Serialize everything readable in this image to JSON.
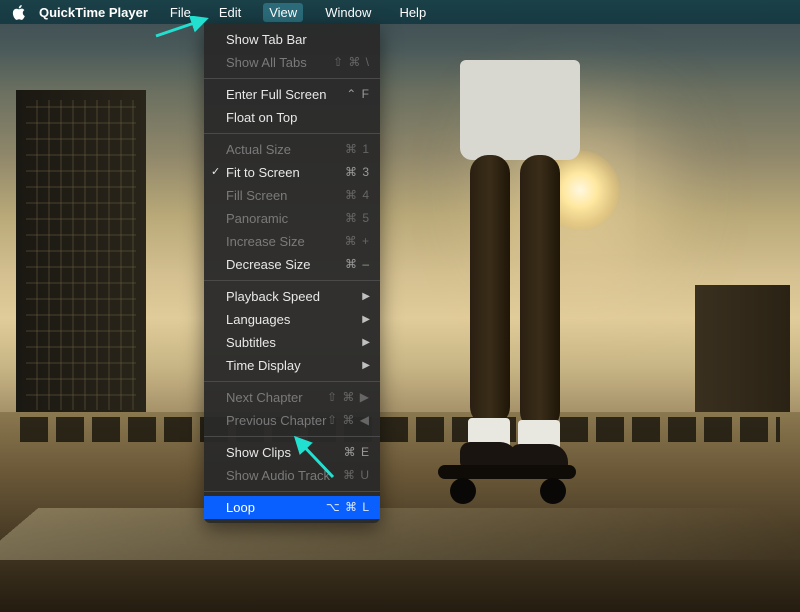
{
  "menubar": {
    "app_name": "QuickTime Player",
    "items": [
      {
        "label": "File",
        "active": false
      },
      {
        "label": "Edit",
        "active": false
      },
      {
        "label": "View",
        "active": true
      },
      {
        "label": "Window",
        "active": false
      },
      {
        "label": "Help",
        "active": false
      }
    ]
  },
  "view_menu": {
    "groups": [
      [
        {
          "label": "Show Tab Bar",
          "shortcut": "",
          "enabled": true,
          "checked": false,
          "submenu": false
        },
        {
          "label": "Show All Tabs",
          "shortcut": "⇧ ⌘ \\",
          "enabled": false,
          "checked": false,
          "submenu": false
        }
      ],
      [
        {
          "label": "Enter Full Screen",
          "shortcut": "⌃ F",
          "enabled": true,
          "checked": false,
          "submenu": false
        },
        {
          "label": "Float on Top",
          "shortcut": "",
          "enabled": true,
          "checked": false,
          "submenu": false
        }
      ],
      [
        {
          "label": "Actual Size",
          "shortcut": "⌘ 1",
          "enabled": false,
          "checked": false,
          "submenu": false
        },
        {
          "label": "Fit to Screen",
          "shortcut": "⌘ 3",
          "enabled": true,
          "checked": true,
          "submenu": false
        },
        {
          "label": "Fill Screen",
          "shortcut": "⌘ 4",
          "enabled": false,
          "checked": false,
          "submenu": false
        },
        {
          "label": "Panoramic",
          "shortcut": "⌘ 5",
          "enabled": false,
          "checked": false,
          "submenu": false
        },
        {
          "label": "Increase Size",
          "shortcut": "⌘ +",
          "enabled": false,
          "checked": false,
          "submenu": false
        },
        {
          "label": "Decrease Size",
          "shortcut": "⌘ –",
          "enabled": true,
          "checked": false,
          "submenu": false
        }
      ],
      [
        {
          "label": "Playback Speed",
          "shortcut": "",
          "enabled": true,
          "checked": false,
          "submenu": true
        },
        {
          "label": "Languages",
          "shortcut": "",
          "enabled": true,
          "checked": false,
          "submenu": true
        },
        {
          "label": "Subtitles",
          "shortcut": "",
          "enabled": true,
          "checked": false,
          "submenu": true
        },
        {
          "label": "Time Display",
          "shortcut": "",
          "enabled": true,
          "checked": false,
          "submenu": true
        }
      ],
      [
        {
          "label": "Next Chapter",
          "shortcut": "⇧ ⌘ ▶",
          "enabled": false,
          "checked": false,
          "submenu": false
        },
        {
          "label": "Previous Chapter",
          "shortcut": "⇧ ⌘ ◀",
          "enabled": false,
          "checked": false,
          "submenu": false
        }
      ],
      [
        {
          "label": "Show Clips",
          "shortcut": "⌘ E",
          "enabled": true,
          "checked": false,
          "submenu": false
        },
        {
          "label": "Show Audio Track",
          "shortcut": "⌘ U",
          "enabled": false,
          "checked": false,
          "submenu": false
        }
      ],
      [
        {
          "label": "Loop",
          "shortcut": "⌥ ⌘ L",
          "enabled": true,
          "checked": false,
          "submenu": false,
          "highlighted": true
        }
      ]
    ]
  },
  "annotations": {
    "arrow_color": "#22e0d0"
  }
}
